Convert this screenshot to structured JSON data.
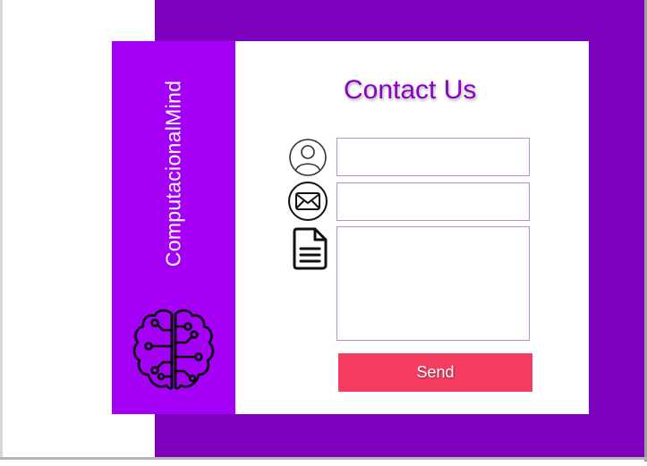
{
  "brand": {
    "name": "ComputacionalMind",
    "logo_icon": "brain-circuit-icon"
  },
  "contact": {
    "title": "Contact Us",
    "fields": [
      {
        "icon": "user-icon",
        "value": "",
        "placeholder": ""
      },
      {
        "icon": "envelope-icon",
        "value": "",
        "placeholder": ""
      },
      {
        "icon": "document-icon",
        "value": "",
        "placeholder": ""
      }
    ],
    "send_label": "Send"
  },
  "colors": {
    "background_purple": "#7d00bd",
    "sidebar_purple": "#a400f5",
    "title_purple": "#8a00c8",
    "send_button": "#f53d60"
  }
}
